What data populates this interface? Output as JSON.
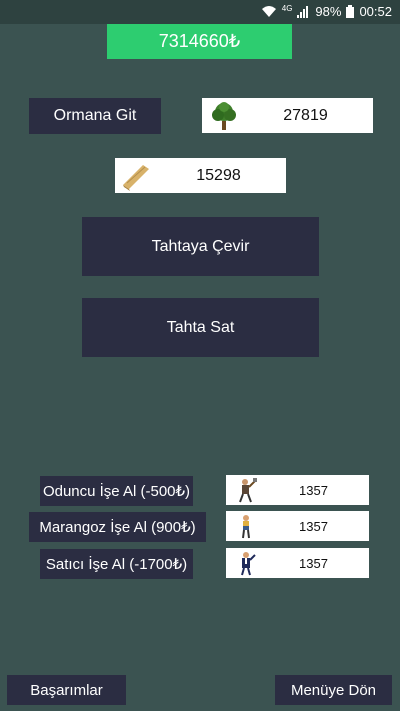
{
  "status_bar": {
    "network": "4G",
    "battery": "98%",
    "time": "00:52"
  },
  "money": "7314660₺",
  "forest_button": "Ormana Git",
  "tree_count": "27819",
  "plank_count": "15298",
  "convert_button": "Tahtaya Çevir",
  "sell_button": "Tahta Sat",
  "hire": [
    {
      "label": "Oduncu İşe Al (-500₺)",
      "count": "1357",
      "icon": "lumberjack-icon"
    },
    {
      "label": "Marangoz İşe Al (900₺)",
      "count": "1357",
      "icon": "carpenter-icon"
    },
    {
      "label": "Satıcı İşe Al (-1700₺)",
      "count": "1357",
      "icon": "seller-icon"
    }
  ],
  "achievements_button": "Başarımlar",
  "menu_button": "Menüye Dön",
  "colors": {
    "background": "#3b5351",
    "money_bar": "#2dcd70",
    "button": "#2b2d42"
  }
}
